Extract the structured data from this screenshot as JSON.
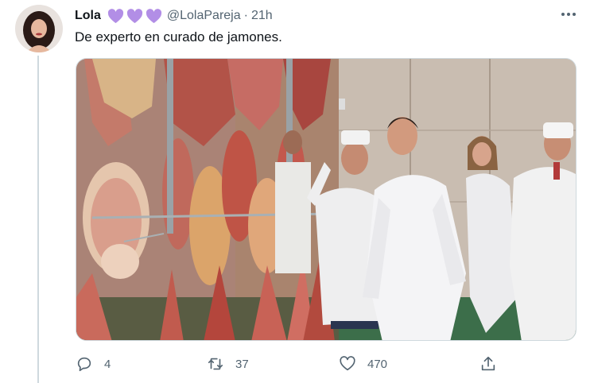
{
  "tweet": {
    "author_name": "Lola",
    "handle": "@LolaPareja",
    "separator": "·",
    "time": "21h",
    "text": "De experto en curado de jamones.",
    "name_emoji": "purple-heart ×3",
    "accent_color": "#b28ee6"
  },
  "actions": {
    "replies": "4",
    "retweets": "37",
    "likes": "470"
  },
  "icons": {
    "more": "more-options-icon",
    "reply": "reply-icon",
    "retweet": "retweet-icon",
    "like": "heart-icon",
    "share": "share-icon"
  }
}
